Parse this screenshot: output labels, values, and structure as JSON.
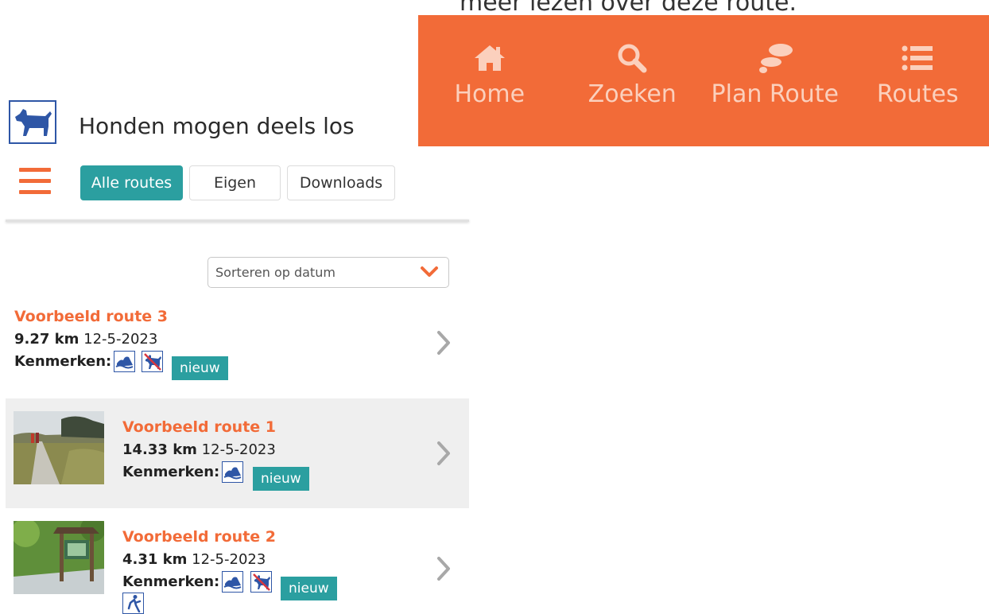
{
  "page": {
    "clipped_text": "meer lezen over deze route."
  },
  "tabbar": {
    "bg": "#f26b38",
    "items": [
      {
        "label": "Home",
        "icon": "home-icon"
      },
      {
        "label": "Zoeken",
        "icon": "search-icon"
      },
      {
        "label": "Plan Route",
        "icon": "footsteps-icon"
      },
      {
        "label": "Routes",
        "icon": "list-icon"
      }
    ]
  },
  "rule_heading": {
    "icon": "dog-icon",
    "text": "Honden mogen deels los"
  },
  "filters": {
    "menu_icon": "hamburger-icon",
    "tabs": [
      "Alle routes",
      "Eigen",
      "Downloads"
    ],
    "active": "Alle routes",
    "active_color": "#2b9fa0"
  },
  "sort": {
    "value": "Sorteren op datum",
    "icon": "chevron-down-icon"
  },
  "routes": [
    {
      "title": "Voorbeeld route 3",
      "distance": "9.27 km",
      "date": "12-5-2023",
      "features_label": "Kenmerken:",
      "features": [
        "water-icon",
        "no-dogs-icon"
      ],
      "badge": "nieuw",
      "has_thumbnail": false
    },
    {
      "title": "Voorbeeld route 1",
      "distance": "14.33 km",
      "date": "12-5-2023",
      "features_label": "Kenmerken:",
      "features": [
        "water-icon"
      ],
      "badge": "nieuw",
      "has_thumbnail": true
    },
    {
      "title": "Voorbeeld route 2",
      "distance": "4.31 km",
      "date": "12-5-2023",
      "features_label": "Kenmerken:",
      "features": [
        "water-icon",
        "no-dogs-icon",
        "wheelchair-icon"
      ],
      "badge": "nieuw",
      "has_thumbnail": true
    }
  ],
  "colors": {
    "accent": "#f26b38",
    "teal": "#2b9fa0",
    "icon_blue": "#2e56a6",
    "row_alt_bg": "#efefef"
  }
}
